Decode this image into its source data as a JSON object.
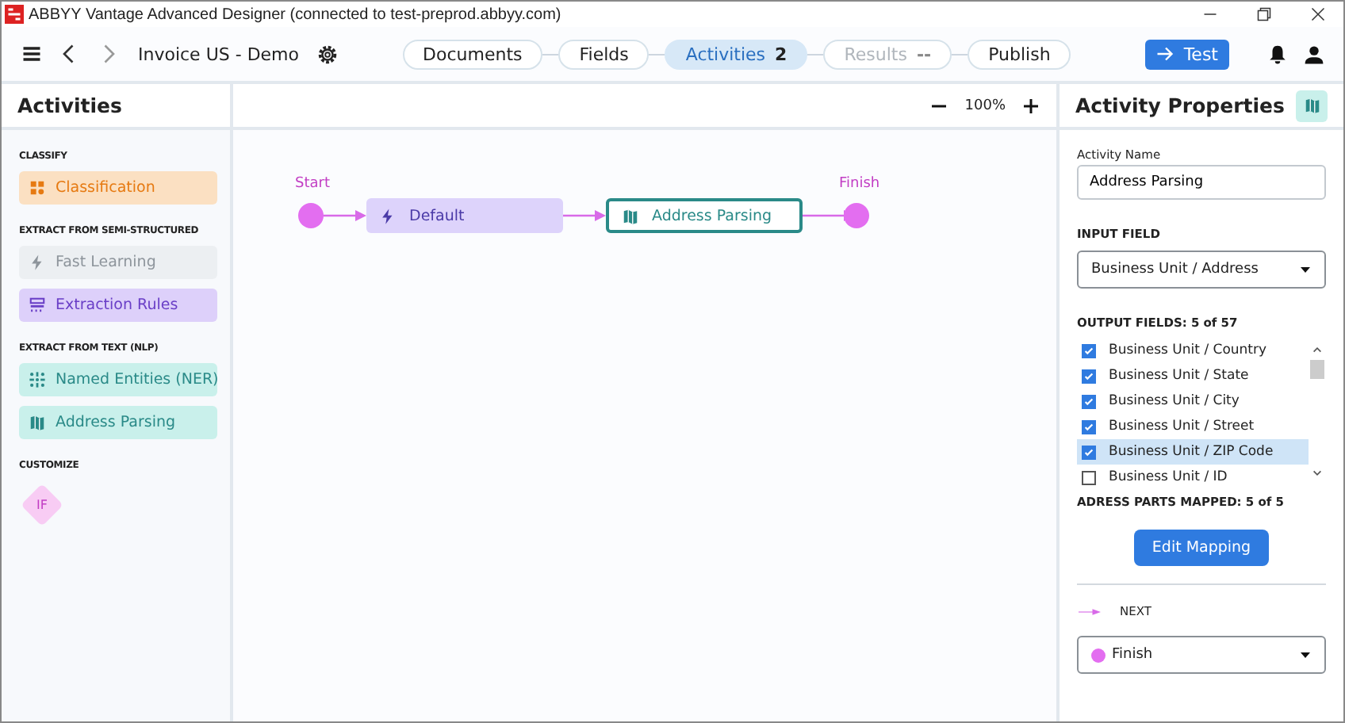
{
  "window": {
    "title": "ABBYY Vantage Advanced Designer (connected to test-preprod.abbyy.com)"
  },
  "toolbar": {
    "project": "Invoice US - Demo",
    "test_button": "Test"
  },
  "steps": [
    {
      "label": "Documents",
      "selected": false,
      "disabled": false
    },
    {
      "label": "Fields",
      "selected": false,
      "disabled": false
    },
    {
      "label": "Activities",
      "count": "2",
      "selected": true,
      "disabled": false
    },
    {
      "label": "Results",
      "count": "--",
      "selected": false,
      "disabled": true
    },
    {
      "label": "Publish",
      "selected": false,
      "disabled": false
    }
  ],
  "sidebar": {
    "title": "Activities",
    "groups": [
      {
        "heading": "CLASSIFY",
        "items": [
          {
            "kind": "classification",
            "label": "Classification"
          }
        ]
      },
      {
        "heading": "EXTRACT FROM SEMI-STRUCTURED",
        "items": [
          {
            "kind": "fast-learning",
            "label": "Fast Learning",
            "disabled": true
          },
          {
            "kind": "extraction-rules",
            "label": "Extraction Rules"
          }
        ]
      },
      {
        "heading": "EXTRACT FROM TEXT (NLP)",
        "items": [
          {
            "kind": "ner",
            "label": "Named Entities (NER)"
          },
          {
            "kind": "address",
            "label": "Address Parsing"
          }
        ]
      },
      {
        "heading": "CUSTOMIZE",
        "items": [
          {
            "kind": "if",
            "label": "IF"
          }
        ]
      }
    ]
  },
  "canvas": {
    "zoom": "100%",
    "start_label": "Start",
    "finish_label": "Finish",
    "nodes": [
      {
        "kind": "fast-learning",
        "label": "Default",
        "selected": false
      },
      {
        "kind": "address",
        "label": "Address Parsing",
        "selected": true
      }
    ]
  },
  "properties": {
    "title": "Activity Properties",
    "name_label": "Activity Name",
    "name_value": "Address Parsing",
    "input_heading": "INPUT FIELD",
    "input_value": "Business Unit / Address",
    "output_heading": "OUTPUT FIELDS: 5 of 57",
    "output_fields": [
      {
        "label": "Business Unit / Country",
        "checked": true,
        "selected": false
      },
      {
        "label": "Business Unit / State",
        "checked": true,
        "selected": false
      },
      {
        "label": "Business Unit / City",
        "checked": true,
        "selected": false
      },
      {
        "label": "Business Unit / Street",
        "checked": true,
        "selected": false
      },
      {
        "label": "Business Unit / ZIP Code",
        "checked": true,
        "selected": true
      },
      {
        "label": "Business Unit / ID",
        "checked": false,
        "selected": false
      }
    ],
    "mapped": "ADRESS PARTS MAPPED: 5 of 5",
    "edit_button": "Edit Mapping",
    "next_label": "NEXT",
    "next_value": "Finish"
  }
}
